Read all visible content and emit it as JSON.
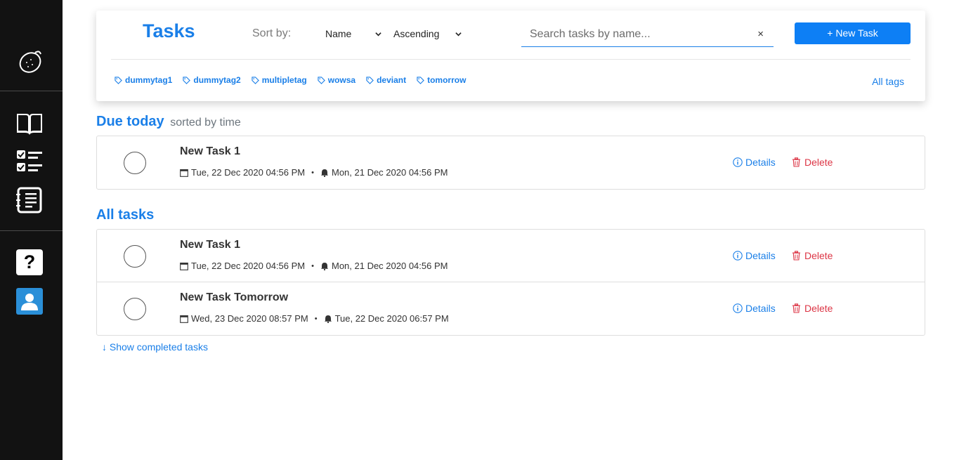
{
  "sidebar": {
    "items": [
      {
        "name": "logo",
        "icon": "lemon-logo-icon"
      },
      {
        "name": "journal",
        "icon": "open-book-icon"
      },
      {
        "name": "tasks",
        "icon": "checklist-icon"
      },
      {
        "name": "notes",
        "icon": "notepad-icon"
      },
      {
        "name": "help",
        "icon": "help-icon",
        "label": "?"
      },
      {
        "name": "profile",
        "icon": "user-icon"
      }
    ],
    "accent": "#2a8fd8",
    "background": "#121212"
  },
  "header": {
    "title": "Tasks",
    "sort_label": "Sort by:",
    "sort_field": "Name",
    "sort_order": "Ascending",
    "search_placeholder": "Search tasks by name...",
    "search_value": "",
    "clear_label": "×",
    "new_task_label": "+  New Task",
    "tags": [
      "dummytag1",
      "dummytag2",
      "multipletag",
      "wowsa",
      "deviant",
      "tomorrow"
    ],
    "all_tags_label": "All tags"
  },
  "due_today": {
    "heading": "Due today",
    "subheading": "sorted by time",
    "tasks": [
      {
        "name": "New Task 1",
        "due": "Tue, 22 Dec 2020 04:56 PM",
        "reminder": "Mon, 21 Dec 2020 04:56 PM",
        "details_label": "Details",
        "delete_label": "Delete"
      }
    ]
  },
  "all_tasks": {
    "heading": "All tasks",
    "tasks": [
      {
        "name": "New Task 1",
        "due": "Tue, 22 Dec 2020 04:56 PM",
        "reminder": "Mon, 21 Dec 2020 04:56 PM",
        "details_label": "Details",
        "delete_label": "Delete"
      },
      {
        "name": "New Task Tomorrow",
        "due": "Wed, 23 Dec 2020 08:57 PM",
        "reminder": "Tue, 22 Dec 2020 06:57 PM",
        "details_label": "Details",
        "delete_label": "Delete"
      }
    ]
  },
  "show_completed_label": "↓ Show completed tasks",
  "colors": {
    "primary": "#1a7fe8",
    "button": "#0d7ff5",
    "danger": "#dc3545"
  }
}
